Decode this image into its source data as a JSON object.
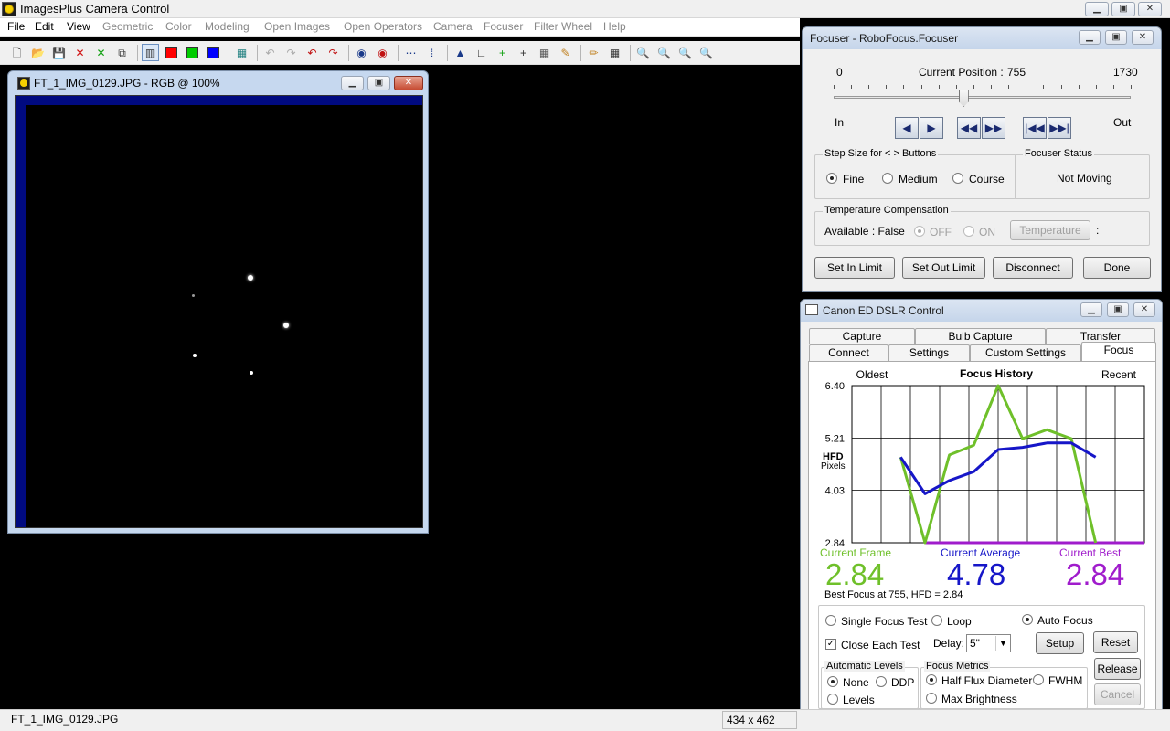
{
  "app": {
    "title": "ImagesPlus Camera Control",
    "menu": [
      {
        "label": "File",
        "enabled": true
      },
      {
        "label": "Edit",
        "enabled": true
      },
      {
        "label": "View",
        "enabled": true
      },
      {
        "label": "Geometric",
        "enabled": false
      },
      {
        "label": "Color",
        "enabled": false
      },
      {
        "label": "Modeling",
        "enabled": false
      },
      {
        "label": "Open Images",
        "enabled": false
      },
      {
        "label": "Open Operators",
        "enabled": false
      },
      {
        "label": "Camera",
        "enabled": false
      },
      {
        "label": "Focuser",
        "enabled": false
      },
      {
        "label": "Filter Wheel",
        "enabled": false
      },
      {
        "label": "Help",
        "enabled": false
      }
    ],
    "toolbar": [
      {
        "name": "new-file-icon",
        "glyph": "🗋",
        "color": "#333"
      },
      {
        "name": "open-folder-icon",
        "glyph": "📂",
        "color": "#c89a20"
      },
      {
        "name": "save-icon",
        "glyph": "💾",
        "color": "#333"
      },
      {
        "name": "close-image-icon",
        "glyph": "✕",
        "color": "#d01010"
      },
      {
        "name": "close-all-icon",
        "glyph": "✕",
        "color": "#10a010"
      },
      {
        "name": "duplicate-icon",
        "glyph": "⧉",
        "color": "#333"
      },
      {
        "name": "rgb-channel-icon",
        "glyph": "▥",
        "color": "#333",
        "selected": true
      },
      {
        "name": "red-channel-icon",
        "swatch": "#ff0000"
      },
      {
        "name": "green-channel-icon",
        "swatch": "#00cc00"
      },
      {
        "name": "blue-channel-icon",
        "swatch": "#0000ff"
      },
      {
        "name": "grid-icon",
        "glyph": "▦",
        "color": "#208080"
      },
      {
        "name": "undo-icon",
        "glyph": "↶",
        "color": "#aaa"
      },
      {
        "name": "redo-icon",
        "glyph": "↷",
        "color": "#aaa"
      },
      {
        "name": "undo-red-icon",
        "glyph": "↶",
        "color": "#c01010"
      },
      {
        "name": "redo-red-icon",
        "glyph": "↷",
        "color": "#c01010"
      },
      {
        "name": "star-select-icon",
        "glyph": "◉",
        "color": "#1a3a8a"
      },
      {
        "name": "star-remove-icon",
        "glyph": "◉",
        "color": "#c01010"
      },
      {
        "name": "dots-icon",
        "glyph": "⋯",
        "color": "#1a3a8a"
      },
      {
        "name": "point-icon",
        "glyph": "⁞",
        "color": "#1a3a8a"
      },
      {
        "name": "histogram-icon",
        "glyph": "▲",
        "color": "#1a3a8a"
      },
      {
        "name": "curve-icon",
        "glyph": "∟",
        "color": "#333"
      },
      {
        "name": "crosshair-green-icon",
        "glyph": "+",
        "color": "#10a010"
      },
      {
        "name": "crosshair-icon",
        "glyph": "+",
        "color": "#333"
      },
      {
        "name": "calculator-icon",
        "glyph": "▦",
        "color": "#555"
      },
      {
        "name": "paint-icon",
        "glyph": "✎",
        "color": "#c08020"
      },
      {
        "name": "pencil-icon",
        "glyph": "✏",
        "color": "#c08020"
      },
      {
        "name": "table-icon",
        "glyph": "▦",
        "color": "#333"
      },
      {
        "name": "zoom-in-icon",
        "glyph": "🔍",
        "color": "#333"
      },
      {
        "name": "zoom-out-icon",
        "glyph": "🔍",
        "color": "#333"
      },
      {
        "name": "zoom-fit-icon",
        "glyph": "🔍",
        "color": "#333"
      },
      {
        "name": "zoom-actual-icon",
        "glyph": "🔍",
        "color": "#333"
      }
    ],
    "status": {
      "filename": "FT_1_IMG_0129.JPG",
      "size": "434 x 462"
    }
  },
  "image_window": {
    "title": "FT_1_IMG_0129.JPG - RGB @ 100%"
  },
  "focuser": {
    "title": "Focuser - RoboFocus.Focuser",
    "min": "0",
    "max": "1730",
    "position_label": "Current Position :",
    "position": "755",
    "position_value": 755,
    "in_label": "In",
    "out_label": "Out",
    "step_group": "Step Size for < > Buttons",
    "step_options": [
      "Fine",
      "Medium",
      "Course"
    ],
    "status_group": "Focuser Status",
    "status": "Not Moving",
    "temp_group": "Temperature Compensation",
    "temp_available": "Available : False",
    "temp_off": "OFF",
    "temp_on": "ON",
    "temp_button": "Temperature",
    "temp_suffix": ":",
    "buttons": {
      "set_in": "Set In Limit",
      "set_out": "Set Out Limit",
      "disconnect": "Disconnect",
      "done": "Done"
    }
  },
  "dslr": {
    "title": "Canon ED DSLR Control",
    "tabs_row1": [
      "Capture",
      "Bulb Capture",
      "Transfer"
    ],
    "tabs_row2": [
      "Connect",
      "Settings",
      "Custom Settings",
      "Focus"
    ],
    "current_frame_label": "Current Frame",
    "current_frame": "2.84",
    "current_avg_label": "Current Average",
    "current_avg": "4.78",
    "current_best_label": "Current Best",
    "current_best": "2.84",
    "best_focus": "Best Focus at 755, HFD =  2.84",
    "options": {
      "single": "Single Focus Test",
      "loop": "Loop",
      "auto": "Auto Focus",
      "close_each": "Close Each Test",
      "delay_label": "Delay:",
      "delay_value": "5\"",
      "setup": "Setup",
      "reset": "Reset"
    },
    "levels_group": "Automatic Levels",
    "levels": {
      "none": "None",
      "ddp": "DDP",
      "levels": "Levels"
    },
    "metrics_group": "Focus Metrics",
    "metrics": {
      "hfd": "Half Flux Diameter",
      "fwhm": "FWHM",
      "max": "Max Brightness"
    },
    "release": "Release",
    "cancel": "Cancel"
  },
  "colors": {
    "frame_series": "#6fc02a",
    "average_series": "#1616c8",
    "best_series": "#a01ccc"
  },
  "chart_data": {
    "type": "line",
    "title": "Focus History",
    "left_label": "Oldest",
    "right_label": "Recent",
    "ylabel": "HFD",
    "ylabel_unit": "Pixels",
    "ylim": [
      2.84,
      6.4
    ],
    "y_ticks": [
      "6.40",
      "5.21",
      "4.03",
      "2.84"
    ],
    "y_tick_values": [
      6.4,
      5.21,
      4.03,
      2.84
    ],
    "x": [
      0,
      1,
      2,
      3,
      4,
      5,
      6,
      7,
      8,
      9,
      10
    ],
    "x_range": [
      -2,
      10
    ],
    "grid": true,
    "series": [
      {
        "name": "Current Frame",
        "values": [
          4.78,
          2.84,
          4.83,
          5.05,
          6.4,
          5.2,
          5.4,
          5.2,
          2.84
        ]
      },
      {
        "name": "Current Average",
        "values": [
          4.78,
          3.95,
          4.25,
          4.45,
          4.95,
          5.0,
          5.1,
          5.1,
          4.78
        ]
      },
      {
        "name": "Current Best",
        "values": [
          null,
          2.84,
          2.84,
          2.84,
          2.84,
          2.84,
          2.84,
          2.84,
          2.84,
          2.84,
          2.84,
          2.84
        ]
      }
    ]
  }
}
